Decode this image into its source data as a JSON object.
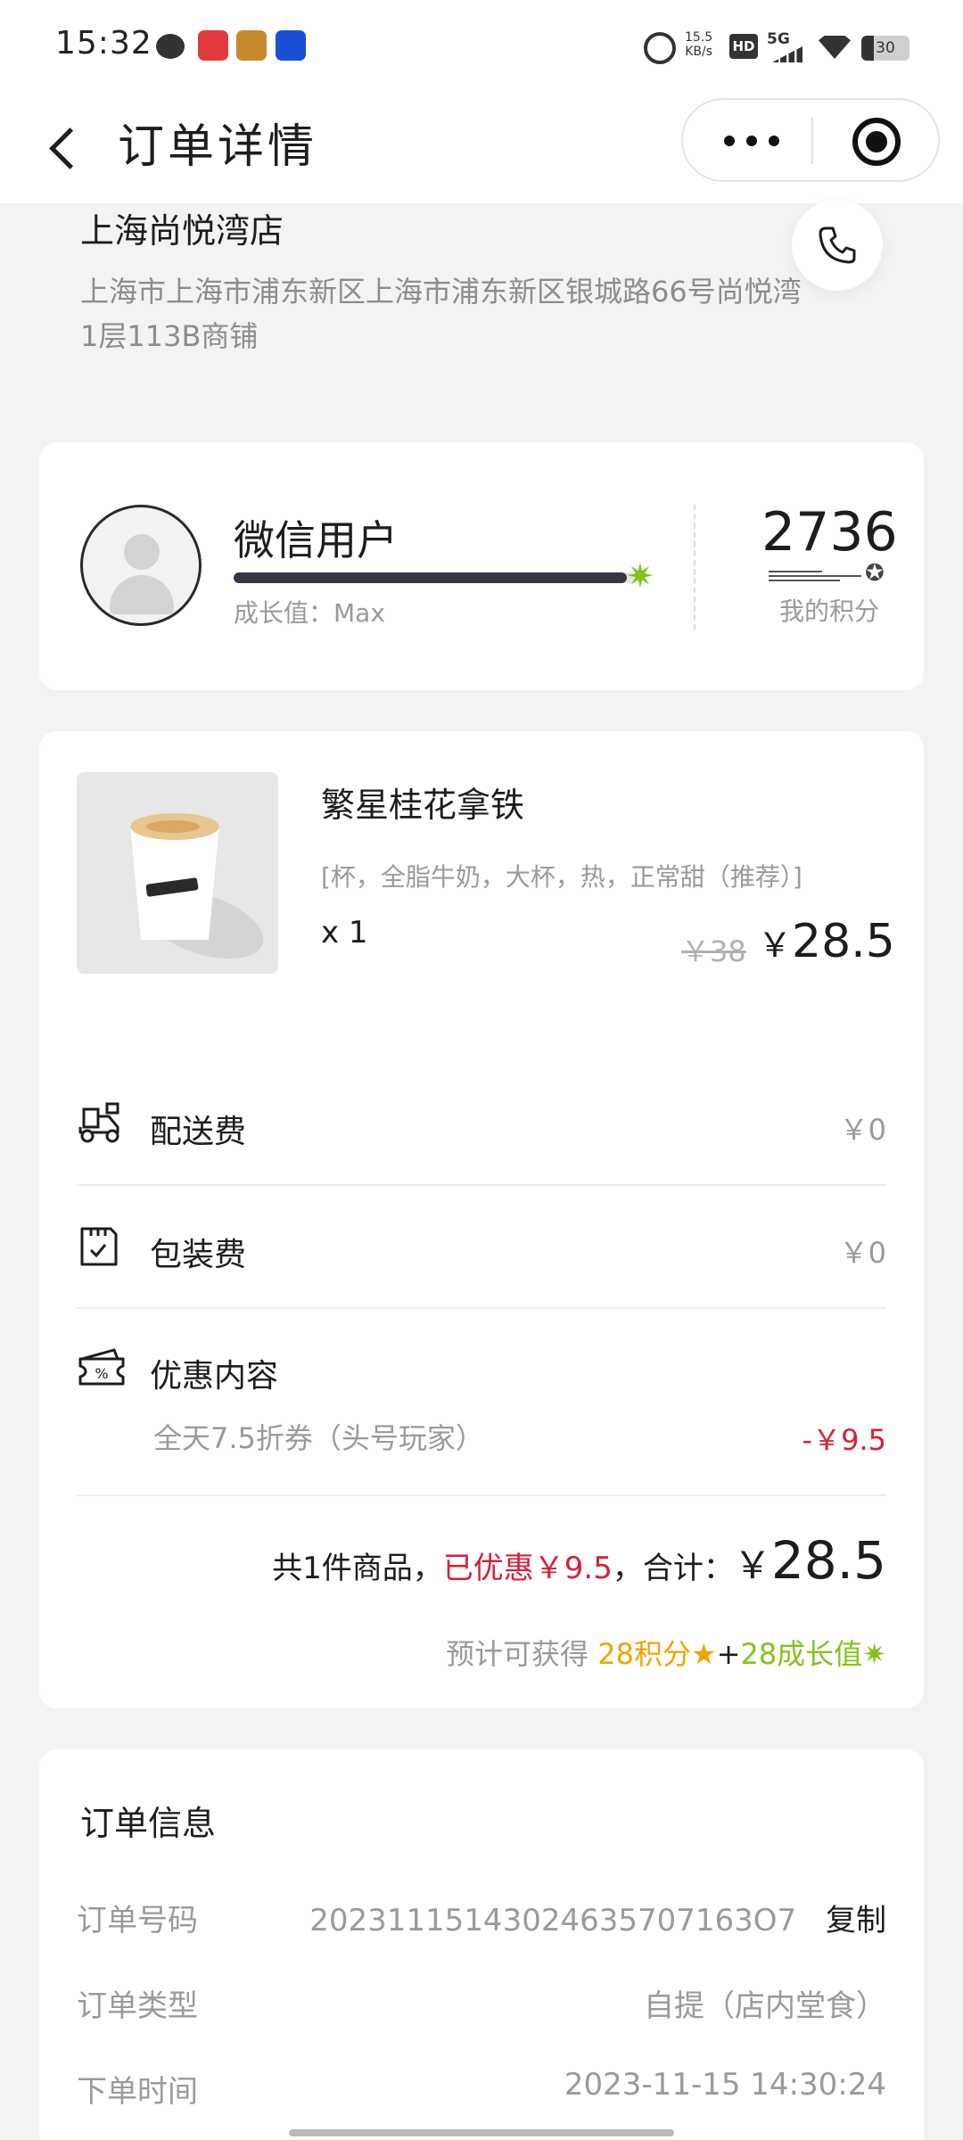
{
  "status_bar": {
    "time": "15:32",
    "net_speed_value": "15.5",
    "net_speed_unit": "KB/s",
    "hd": "HD",
    "network": "5G",
    "battery": "30",
    "icons": [
      "chat-icon",
      "app-icon-red",
      "app-icon-game",
      "app-icon-blue",
      "alarm-icon",
      "signal-icon",
      "wifi-icon",
      "battery-icon"
    ]
  },
  "nav": {
    "title": "订单详情",
    "icons": [
      "back-arrow-icon",
      "more-dots-icon",
      "target-icon"
    ]
  },
  "store": {
    "name": "上海尚悦湾店",
    "address": "上海市上海市浦东新区上海市浦东新区银城路66号尚悦湾1层113B商铺",
    "phone_icon": "phone-icon"
  },
  "member": {
    "name": "微信用户",
    "growth_progress": 0.98,
    "growth_label": "成长值：Max",
    "points": "2736",
    "points_label": "我的积分"
  },
  "order": {
    "product": {
      "name": "繁星桂花拿铁",
      "spec": "[杯，全脂牛奶，大杯，热，正常甜（推荐）]",
      "qty": "x 1",
      "original_price": "￥38",
      "price_symbol": "￥",
      "price": "28.5"
    },
    "fees": [
      {
        "label": "配送费",
        "value": "￥0",
        "icon": "delivery-scooter-icon"
      },
      {
        "label": "包装费",
        "value": "￥0",
        "icon": "package-bag-icon"
      }
    ],
    "discount": {
      "label": "优惠内容",
      "icon": "coupon-icon",
      "name": "全天7.5折券（头号玩家）",
      "amount": "-￥9.5"
    },
    "summary": {
      "count_text": "共1件商品，",
      "saved_text": "已优惠￥9.5",
      "total_prefix": "，合计：",
      "total_symbol": "￥",
      "total": "28.5"
    },
    "earn": {
      "prefix": "预计可获得 ",
      "points": "28积分",
      "points_icon": "★",
      "plus": "+",
      "growth": "28成长值",
      "growth_icon": "✷"
    }
  },
  "info": {
    "title": "订单信息",
    "rows": [
      {
        "label": "订单号码",
        "value": "20231115143024635707163O7",
        "action": "复制"
      },
      {
        "label": "订单类型",
        "value": "自提（店内堂食）"
      },
      {
        "label": "下单时间",
        "value": "2023-11-15 14:30:24"
      }
    ]
  },
  "colors": {
    "accent_red": "#d6203a",
    "points_orange": "#f0a400",
    "growth_green": "#86c21e",
    "bar_dark": "#353744"
  }
}
